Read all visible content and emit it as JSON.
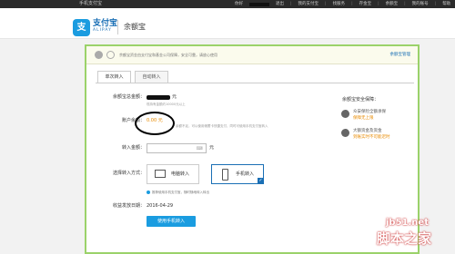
{
  "topbar": {
    "brand": "手机支付宝",
    "greeting": "你好",
    "logout": "退出",
    "my_alipay": "我的支付宝",
    "find_service": "找服务",
    "save_money": "存金宝",
    "yuebao": "余额宝",
    "account": "我的账号",
    "help": "帮助"
  },
  "header": {
    "logo_char": "支",
    "logo_text": "支付宝",
    "logo_sub": "ALIPAY",
    "product": "余额宝"
  },
  "notice": {
    "text": "余额宝资金由支付宝和基金公司保障，安全可靠，请放心使用",
    "manage_link": "余额宝管理"
  },
  "tabs": [
    "单次转入",
    "自动转入"
  ],
  "form": {
    "total_label": "余额宝总金额：",
    "total_unit": "元",
    "total_note": "现持有金额约10000元以上",
    "balance_label": "账户余额：",
    "balance_value": "0.00 元",
    "balance_note": "余额不足，可以使用储蓄卡快捷支付，同时可使用手机支付宝转入",
    "amount_label": "转入金额：",
    "amount_unit": "元",
    "method_label": "选择转入方式：",
    "method_pc": "电脑转入",
    "method_phone": "手机转入",
    "tip": "推荐使用手机支付宝，随时随地转入转出",
    "date_label": "收益发放日期：",
    "date_value": "2016-04-29",
    "submit": "使用手机转入"
  },
  "side": {
    "title": "余额宝安全保障：",
    "items": [
      {
        "t1": "众安保险全额承保",
        "t2": "保障无上限"
      },
      {
        "t1": "大额资金及资金",
        "t2": "到账实时不可能迟时"
      }
    ]
  },
  "watermark": {
    "line1": "jb51.net",
    "line2": "脚本之家"
  }
}
